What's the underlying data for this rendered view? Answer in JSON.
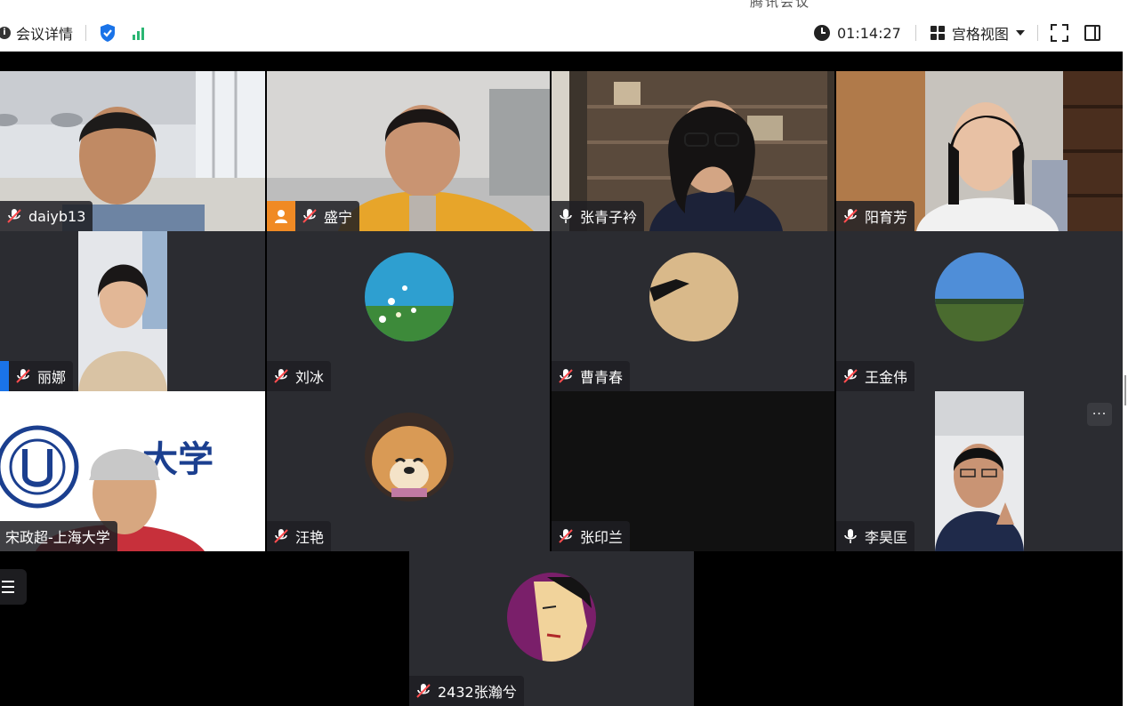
{
  "title_strip": "腾讯会议",
  "toolbar": {
    "meeting_info": "会议详情",
    "timer": "01:14:27",
    "view_mode": "宫格视图"
  },
  "participants": [
    {
      "name": "daiyb13"
    },
    {
      "name": "盛宁"
    },
    {
      "name": "张青子衿"
    },
    {
      "name": "阳育芳"
    },
    {
      "name": "丽娜"
    },
    {
      "name": "刘冰"
    },
    {
      "name": "曹青春"
    },
    {
      "name": "王金伟"
    },
    {
      "name": "宋政超-上海大学"
    },
    {
      "name": "汪艳"
    },
    {
      "name": "张印兰"
    },
    {
      "name": "李昊匡"
    },
    {
      "name": "2432张瀚兮"
    }
  ],
  "more_label": "···",
  "colors": {
    "tile_bg": "#2b2c31",
    "host_badge": "#f08a24",
    "signal": "#2bb673",
    "shield": "#1a73e8"
  }
}
